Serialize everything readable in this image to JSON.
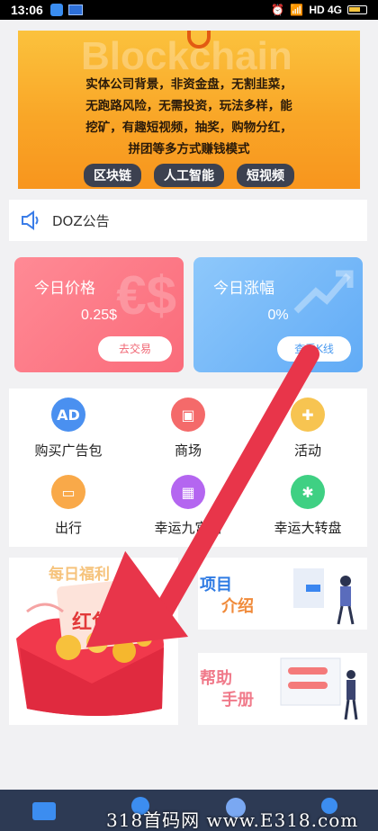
{
  "status_bar": {
    "time": "13:06",
    "network": "HD 4G"
  },
  "banner": {
    "watermark": "Blockchain",
    "tagline_lines": [
      "实体公司背景，非资金盘，无割韭菜，",
      "无跑路风险，无需投资，玩法多样，能",
      "挖矿，有趣短视频，抽奖，购物分红，",
      "拼团等多方式赚钱模式"
    ],
    "tags": [
      "区块链",
      "人工智能",
      "短视频"
    ]
  },
  "notice": {
    "label": "DOZ公告"
  },
  "price_cards": [
    {
      "title": "今日价格",
      "value": "0.25$",
      "button": "去交易"
    },
    {
      "title": "今日涨幅",
      "value": "0%",
      "button": "查看K线"
    }
  ],
  "grid": [
    {
      "label": "购买广告包",
      "icon": "ad-package-icon",
      "color": "#4a90f0"
    },
    {
      "label": "商场",
      "icon": "shopping-bag-icon",
      "color": "#f46a6a"
    },
    {
      "label": "活动",
      "icon": "gift-icon",
      "color": "#f7c451"
    },
    {
      "label": "出行",
      "icon": "car-icon",
      "color": "#f9a949"
    },
    {
      "label": "幸运九宫格",
      "icon": "nine-grid-icon",
      "color": "#b466f0"
    },
    {
      "label": "幸运大转盘",
      "icon": "wheel-icon",
      "color": "#3fd083"
    }
  ],
  "promo": {
    "red_packet_header": "每日福利",
    "red_packet_label": "红包",
    "project_intro_1": "项目",
    "project_intro_2": "介绍",
    "help_1": "帮助",
    "help_2": "手册"
  },
  "site_watermark": "318首码网 www.E318.com",
  "colors": {
    "annotation_arrow": "#e8354a"
  }
}
